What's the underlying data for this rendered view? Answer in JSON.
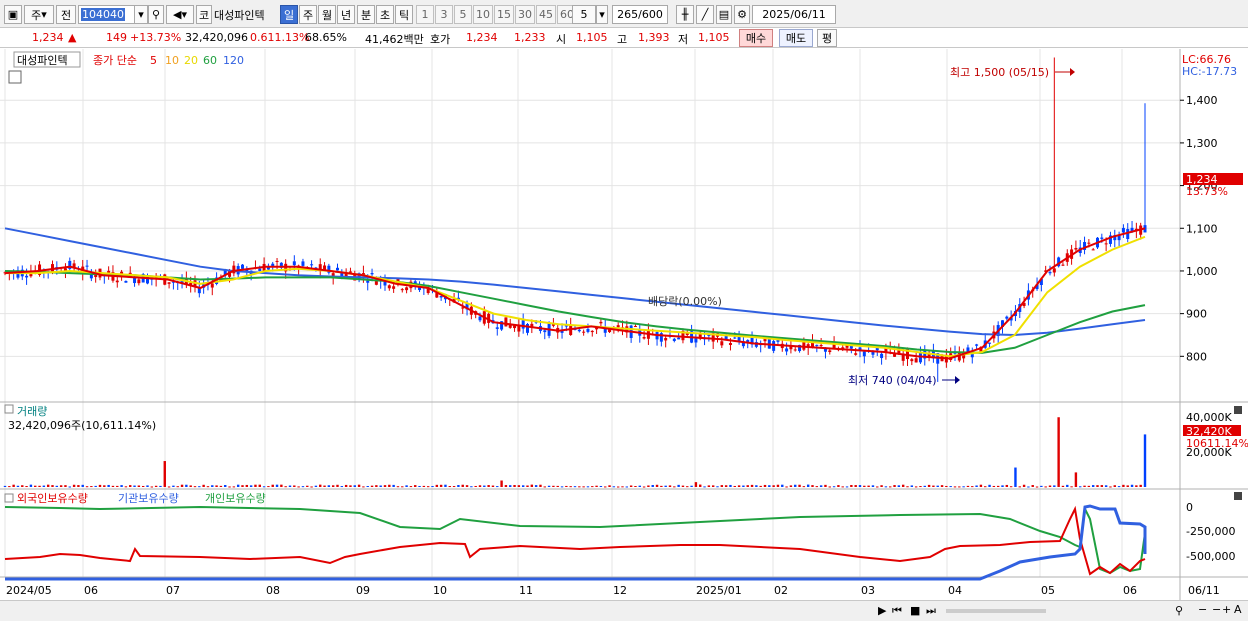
{
  "toolbar": {
    "market_label": "주",
    "prev_label": "전",
    "code": "104040",
    "ko_label": "코",
    "stock_name": "대성파인텍",
    "periods": [
      "일",
      "주",
      "월",
      "년",
      "분",
      "초",
      "틱"
    ],
    "selected_period": "일",
    "minutes": [
      "1",
      "3",
      "5",
      "10",
      "15",
      "30",
      "45",
      "60"
    ],
    "interval_value": "5",
    "count_display": "265",
    "count_total": "/600",
    "date": "2025/06/11"
  },
  "info": {
    "price": "1,234",
    "change": "149",
    "change_pct": "+13.73%",
    "volume": "32,420,096",
    "turnover_pct": "0.611.13%",
    "vol_ratio": "68.65%",
    "amount": "41,462백만",
    "hoga_label": "호가",
    "ask": "1,234",
    "bid": "1,233",
    "open_label": "시",
    "open": "1,105",
    "high_label": "고",
    "high": "1,393",
    "low_label": "저",
    "low": "1,105",
    "buy_btn": "매수",
    "sell_btn": "매도",
    "avg_btn": "평"
  },
  "price_panel": {
    "legend_name": "대성파인텍",
    "legend_ma_label": "종가 단순",
    "ma_periods": [
      "5",
      "10",
      "20",
      "60",
      "120"
    ],
    "ma_colors": [
      "#e00000",
      "#f0a020",
      "#f0e000",
      "#20a040",
      "#3060e0"
    ],
    "lc": "LC:66.76",
    "hc": "HC:-17.73",
    "y_ticks": [
      "1,400",
      "1,300",
      "1,200",
      "1,100",
      "1,000",
      "900",
      "800"
    ],
    "current_price_tag": "1,234",
    "current_pct_tag": "13.73%",
    "high_annotation": "최고 1,500 (05/15)",
    "low_annotation": "최저 740 (04/04)",
    "mid_annotation": "배당락(0.00%)"
  },
  "volume_panel": {
    "title": "거래량",
    "value_label": "32,420,096주(10,611.14%)",
    "y_ticks": [
      "40,000K",
      "20,000K"
    ],
    "tag_value": "32,420K",
    "tag_pct": "10611.14%"
  },
  "holding_panel": {
    "legend": [
      "외국인보유수량",
      "기관보유수량",
      "개인보유수량"
    ],
    "legend_colors": [
      "#e00000",
      "#3060e0",
      "#20a040"
    ],
    "y_ticks": [
      "0",
      "-250,000",
      "-500,000"
    ]
  },
  "x_axis": {
    "labels": [
      "2024/05",
      "06",
      "07",
      "08",
      "09",
      "10",
      "11",
      "12",
      "2025/01",
      "02",
      "03",
      "04",
      "05",
      "06"
    ],
    "right_label": "06/11"
  },
  "chart_data": {
    "type": "candlestick",
    "y_range": [
      700,
      1520
    ],
    "high": {
      "value": 1500,
      "date": "05/15"
    },
    "low": {
      "value": 740,
      "date": "04/04"
    },
    "last_close": 1234,
    "ma_series": {
      "ma5": [
        995,
        1000,
        1010,
        990,
        985,
        980,
        960,
        1000,
        1010,
        1010,
        1000,
        990,
        970,
        960,
        920,
        880,
        870,
        860,
        870,
        860,
        850,
        845,
        840,
        830,
        825,
        820,
        815,
        810,
        800,
        795,
        820,
        900,
        1000,
        1050,
        1080,
        1100
      ],
      "ma20": [
        995,
        995,
        1000,
        995,
        990,
        985,
        970,
        980,
        1000,
        1005,
        1000,
        990,
        975,
        960,
        930,
        900,
        885,
        875,
        870,
        865,
        860,
        855,
        850,
        845,
        838,
        832,
        826,
        820,
        810,
        800,
        810,
        850,
        950,
        1010,
        1050,
        1080
      ],
      "ma60": [
        1000,
        998,
        995,
        992,
        990,
        985,
        980,
        982,
        985,
        985,
        985,
        980,
        975,
        965,
        950,
        935,
        920,
        905,
        892,
        880,
        870,
        862,
        855,
        848,
        842,
        836,
        830,
        824,
        816,
        810,
        808,
        820,
        850,
        880,
        905,
        920
      ],
      "ma120": [
        1100,
        1085,
        1070,
        1055,
        1040,
        1025,
        1010,
        1000,
        995,
        990,
        987,
        985,
        983,
        980,
        975,
        968,
        960,
        952,
        944,
        936,
        928,
        920,
        912,
        904,
        896,
        888,
        880,
        872,
        865,
        858,
        852,
        850,
        855,
        865,
        875,
        885
      ]
    },
    "volume_peaks_k": [
      {
        "month": "06",
        "value": 16000
      },
      {
        "month": "10",
        "value": 3000
      },
      {
        "month": "05",
        "value": 43000
      },
      {
        "month": "06",
        "value": 32420
      }
    ]
  }
}
